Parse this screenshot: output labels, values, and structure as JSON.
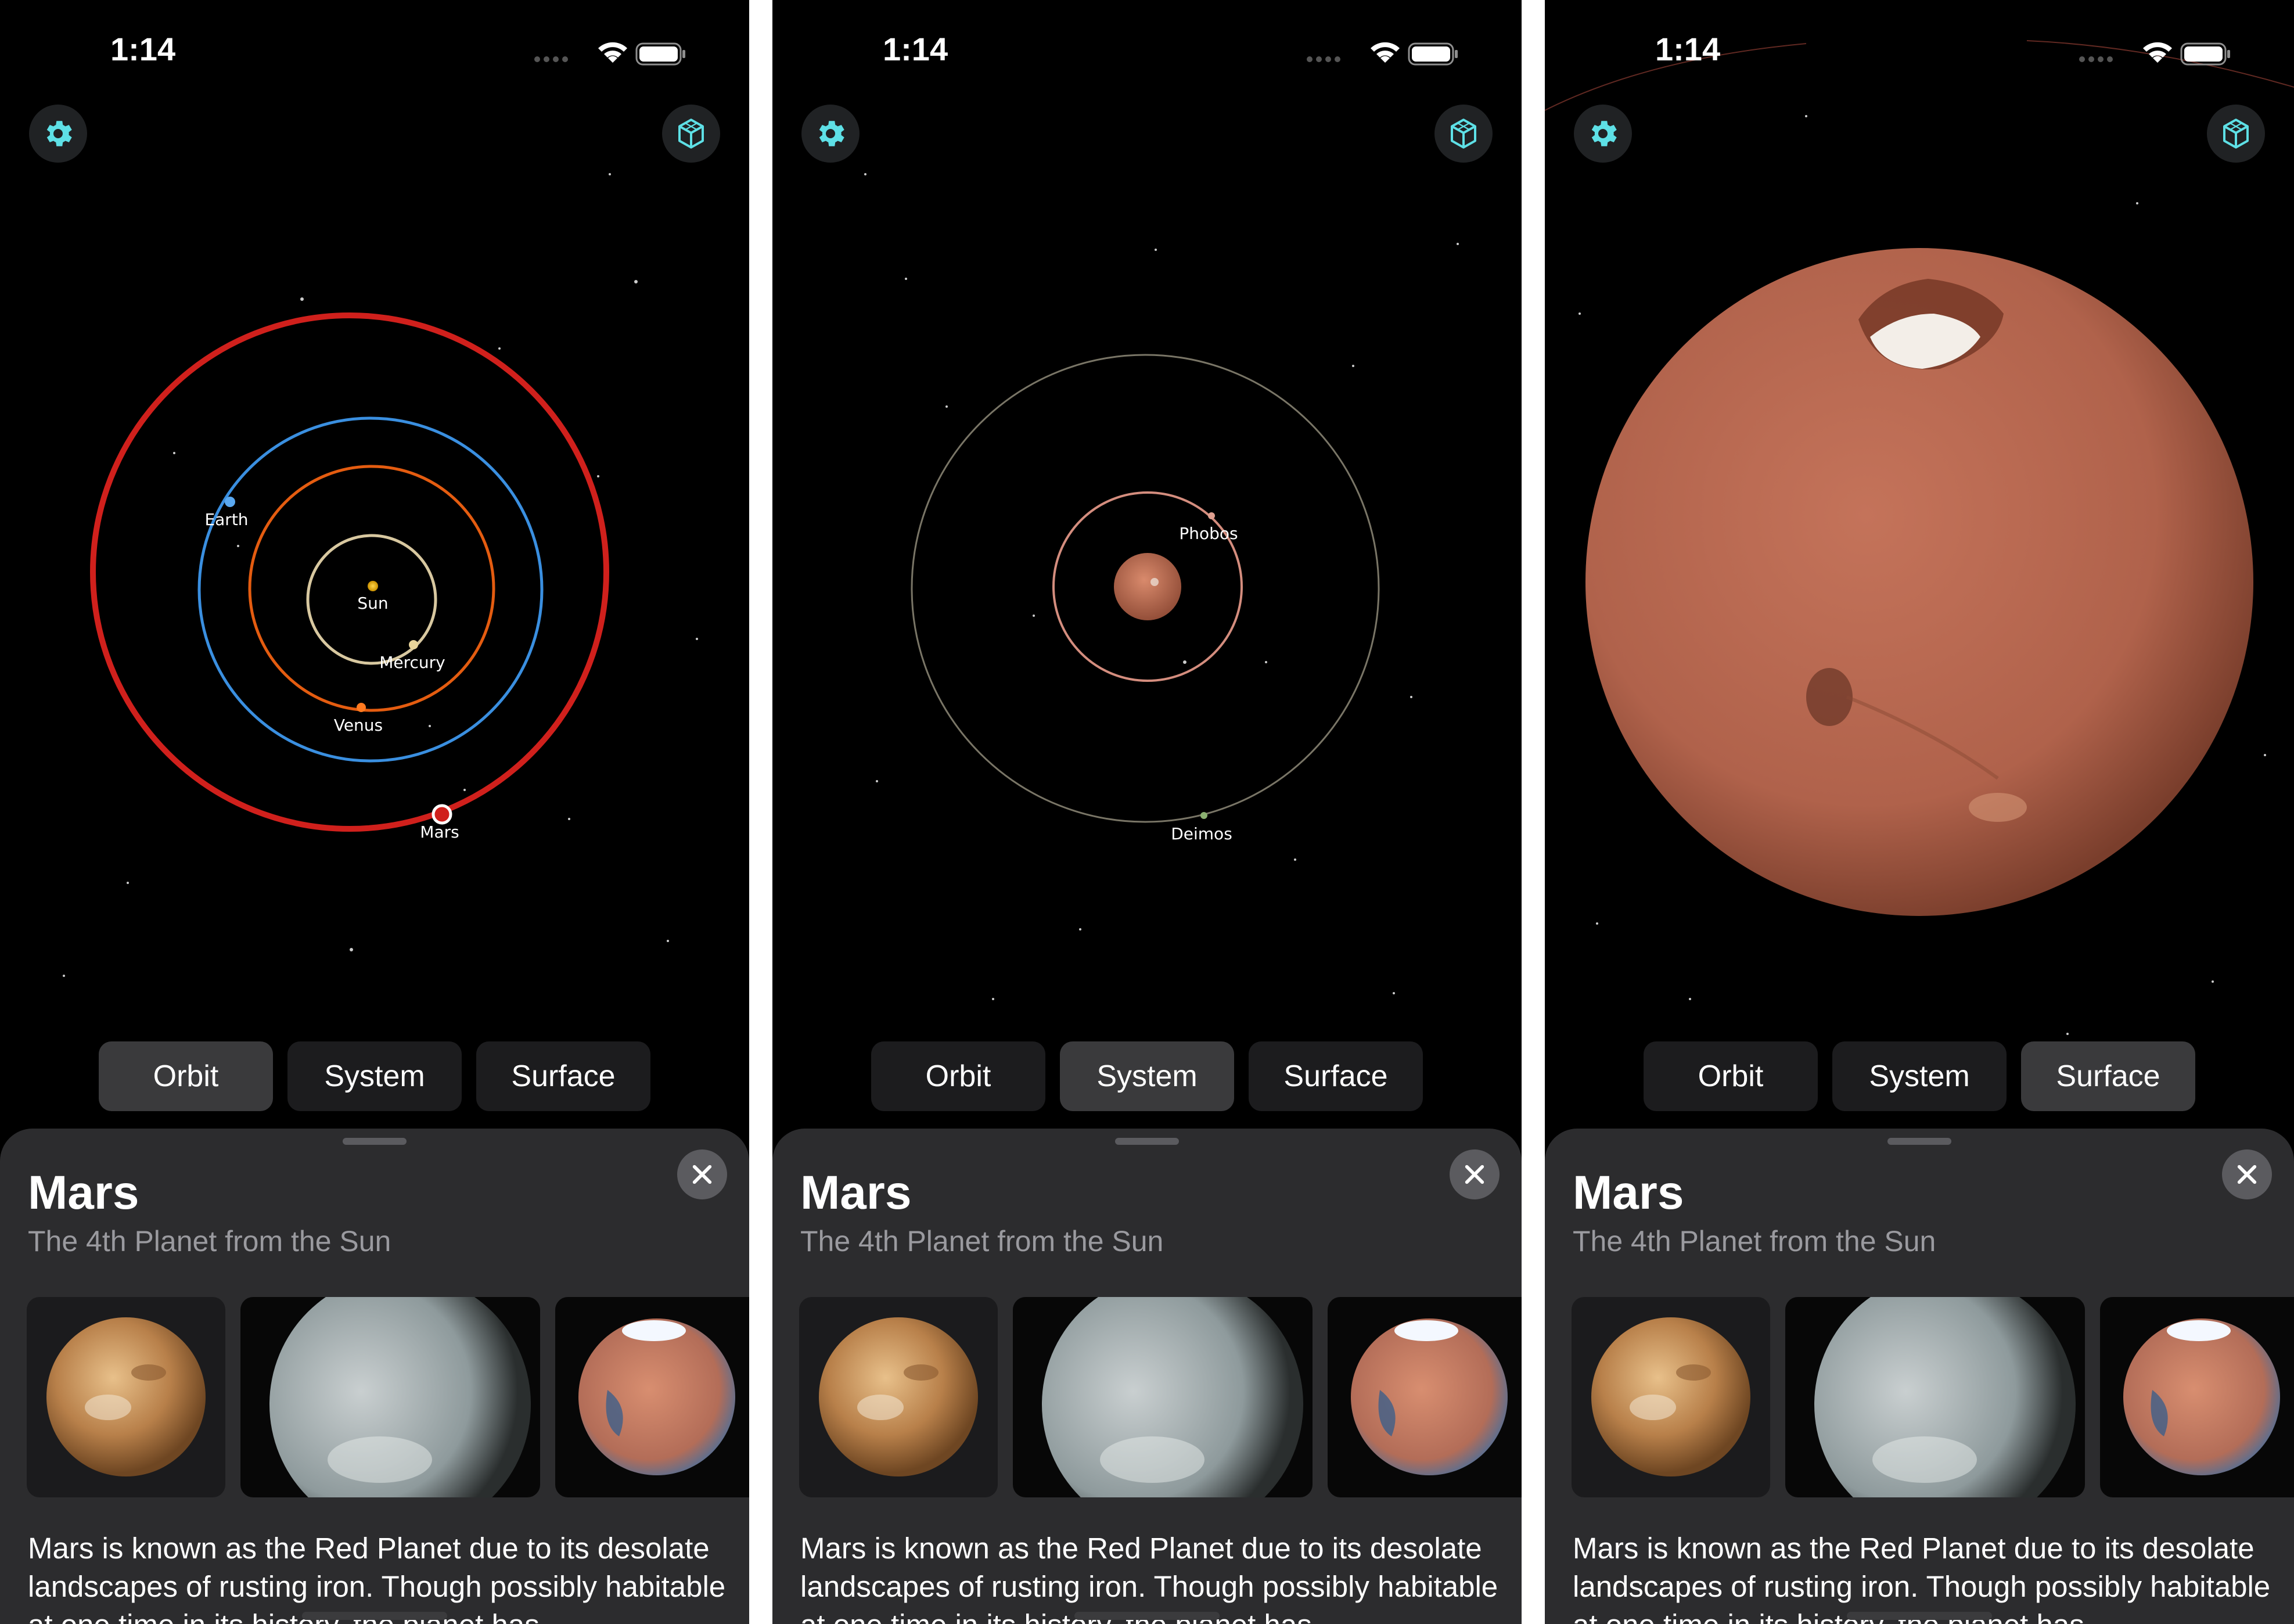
{
  "status": {
    "time": "1:14"
  },
  "toolbar": {
    "settings_icon": "gear-icon",
    "view_icon": "cube-icon"
  },
  "colors": {
    "accent": "#5ee0e6",
    "mars": "#c1634a",
    "sheet": "#2c2c2e"
  },
  "segments": [
    "Orbit",
    "System",
    "Surface"
  ],
  "screens": [
    {
      "selected": "Orbit"
    },
    {
      "selected": "System"
    },
    {
      "selected": "Surface"
    }
  ],
  "orbit_labels": {
    "earth": "Earth",
    "sun": "Sun",
    "mercury": "Mercury",
    "venus": "Venus",
    "mars": "Mars"
  },
  "system_labels": {
    "phobos": "Phobos",
    "deimos": "Deimos"
  },
  "sheet": {
    "title": "Mars",
    "subtitle": "The 4th Planet from the Sun",
    "description": "Mars is known as the Red Planet due to its desolate landscapes of rusting iron. Though possibly habitable at one time in its history, the planet has"
  }
}
